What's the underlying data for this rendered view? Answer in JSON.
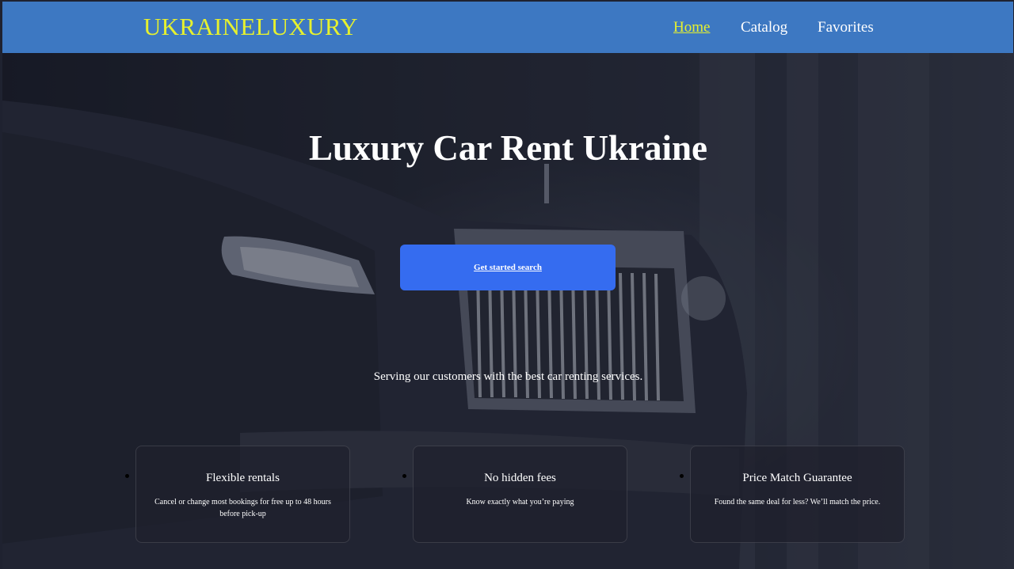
{
  "header": {
    "logo": "UKRAINELUXURY",
    "nav": [
      {
        "label": "Home",
        "active": true
      },
      {
        "label": "Catalog",
        "active": false
      },
      {
        "label": "Favorites",
        "active": false
      }
    ]
  },
  "hero": {
    "title": "Luxury Car Rent Ukraine",
    "cta_label": "Get started search",
    "tagline": "Serving our customers with the best car renting services."
  },
  "features": [
    {
      "title": "Flexible rentals",
      "description": "Cancel or change most bookings for free up to 48 hours before pick-up"
    },
    {
      "title": "No hidden fees",
      "description": "Know exactly what you’re paying"
    },
    {
      "title": "Price Match Guarantee",
      "description": "Found the same deal for less? We’ll match the price."
    }
  ],
  "colors": {
    "header_bg": "#3d78c2",
    "logo": "#e6f12e",
    "cta_bg": "#356cf0"
  }
}
